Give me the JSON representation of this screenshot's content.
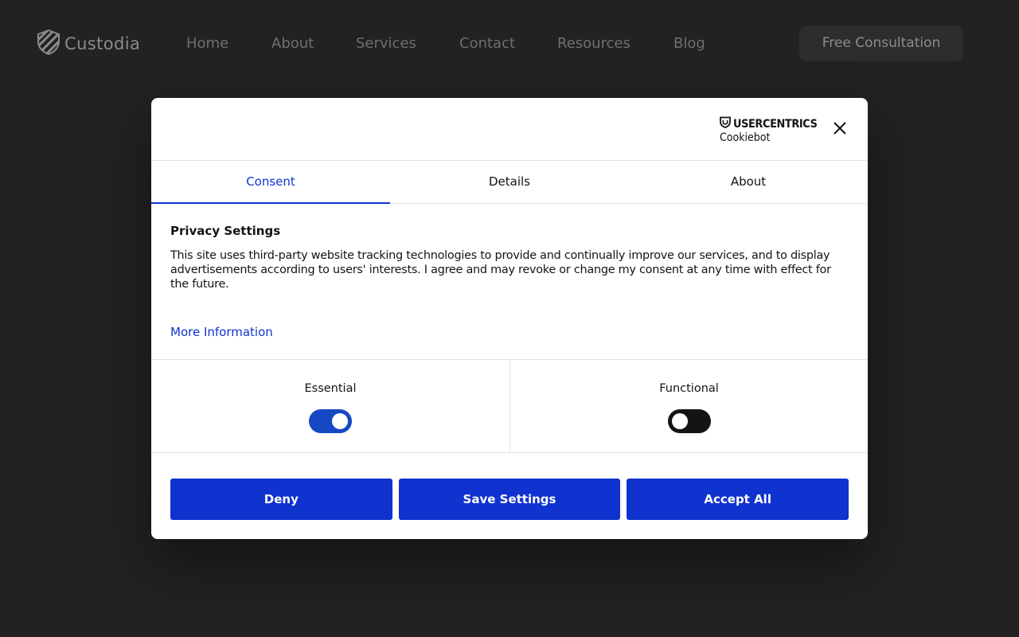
{
  "site": {
    "logo_text": "Custodia",
    "logo_icon": "shield-icon",
    "nav": [
      "Home",
      "About",
      "Services",
      "Contact",
      "Resources",
      "Blog"
    ],
    "cta_label": "Free Consultation"
  },
  "dialog": {
    "brand_name": "USERCENTRICS",
    "brand_sub": "Cookiebot",
    "close_icon": "close-icon",
    "tabs": [
      {
        "label": "Consent",
        "active": true
      },
      {
        "label": "Details",
        "active": false
      },
      {
        "label": "About",
        "active": false
      }
    ],
    "title": "Privacy Settings",
    "body": "This site uses third-party website tracking technologies to provide and continually improve our services, and to display advertisements according to users' interests. I agree and may revoke or change my consent at any time with effect for the future.",
    "more_info": "More Information",
    "toggles": [
      {
        "label": "Essential",
        "on": true
      },
      {
        "label": "Functional",
        "on": false
      }
    ],
    "buttons": {
      "deny": "Deny",
      "save": "Save Settings",
      "accept": "Accept All"
    }
  },
  "colors": {
    "page_bg": "#222222",
    "accent": "#1032cf",
    "toggle_on": "#1648c4",
    "toggle_off": "#141414"
  }
}
